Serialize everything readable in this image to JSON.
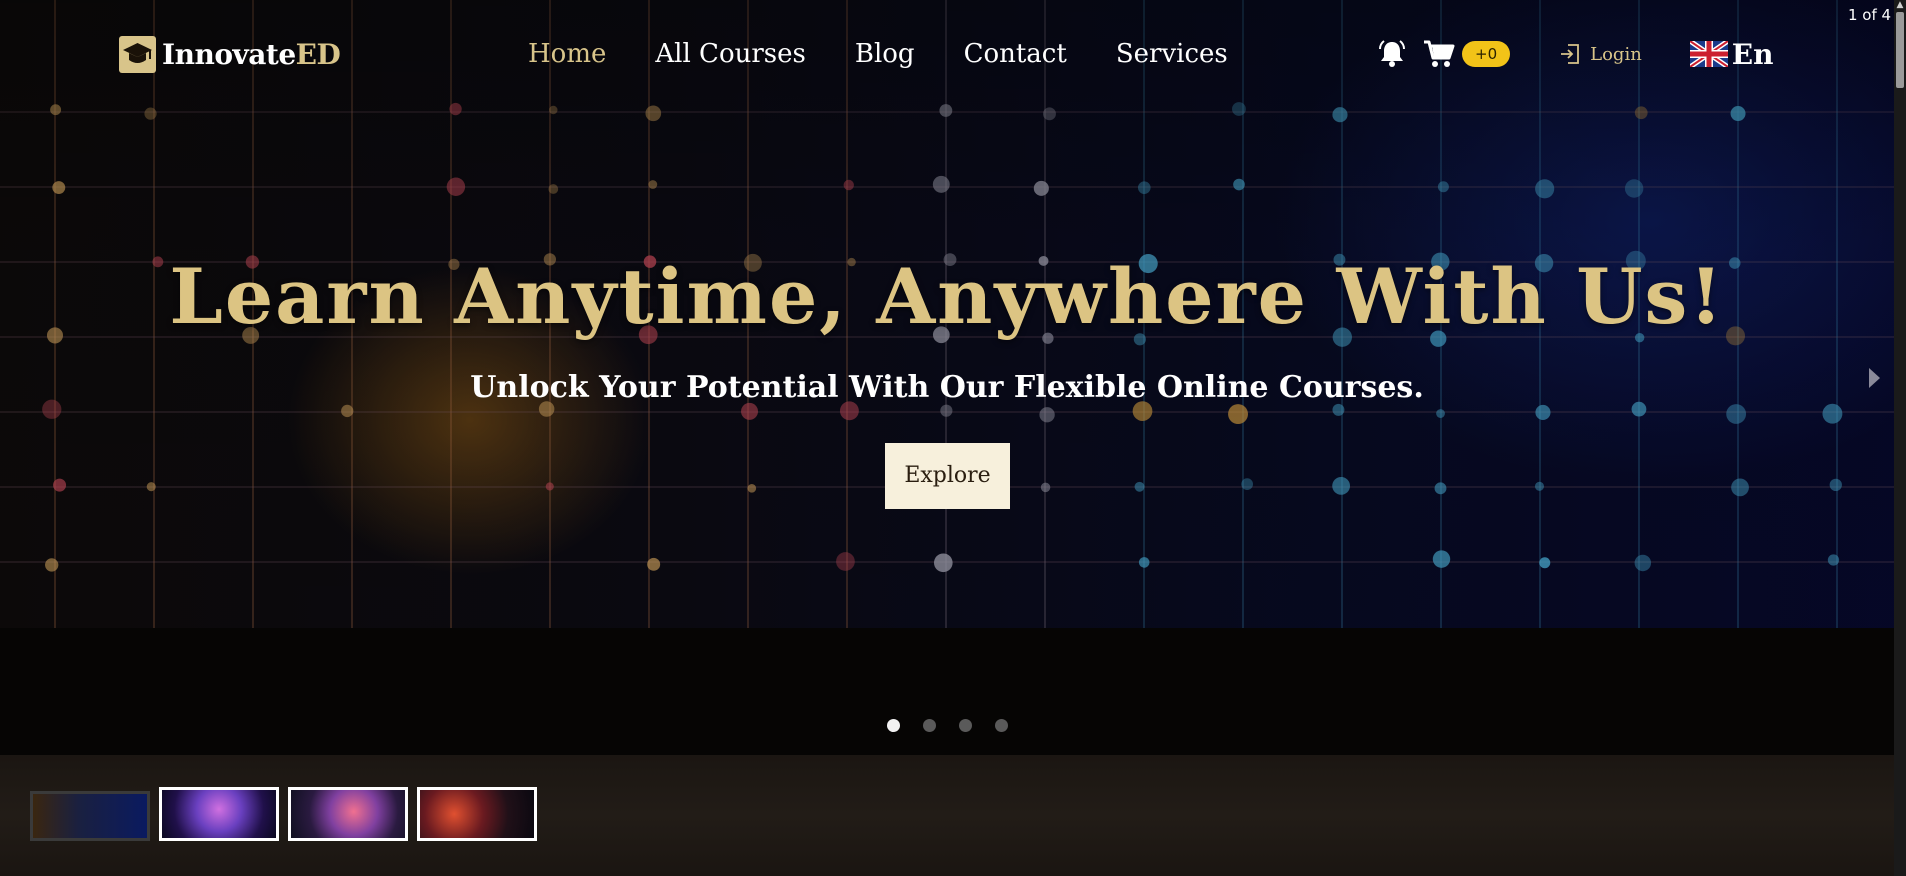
{
  "brand": {
    "name_main": "Innovate",
    "name_accent": "ED"
  },
  "nav": {
    "items": [
      {
        "label": "Home",
        "active": true
      },
      {
        "label": "All Courses",
        "active": false
      },
      {
        "label": "Blog",
        "active": false
      },
      {
        "label": "Contact",
        "active": false
      },
      {
        "label": "Services",
        "active": false
      }
    ]
  },
  "header_actions": {
    "notifications_icon": "bell-icon",
    "cart_icon": "cart-icon",
    "cart_badge": "+0",
    "login_label": "Login",
    "language_label": "En",
    "language_flag": "uk-flag-icon"
  },
  "slider": {
    "counter": "1 of 4",
    "title": "Learn Anytime, Anywhere With Us!",
    "subtitle": "Unlock Your Potential With Our Flexible Online Courses.",
    "cta_label": "Explore",
    "slide_count": 4,
    "active_slide": 1
  },
  "colors": {
    "accent_gold": "#d8c48a",
    "badge_yellow": "#f2c318",
    "cta_background": "#f7f0dc"
  }
}
